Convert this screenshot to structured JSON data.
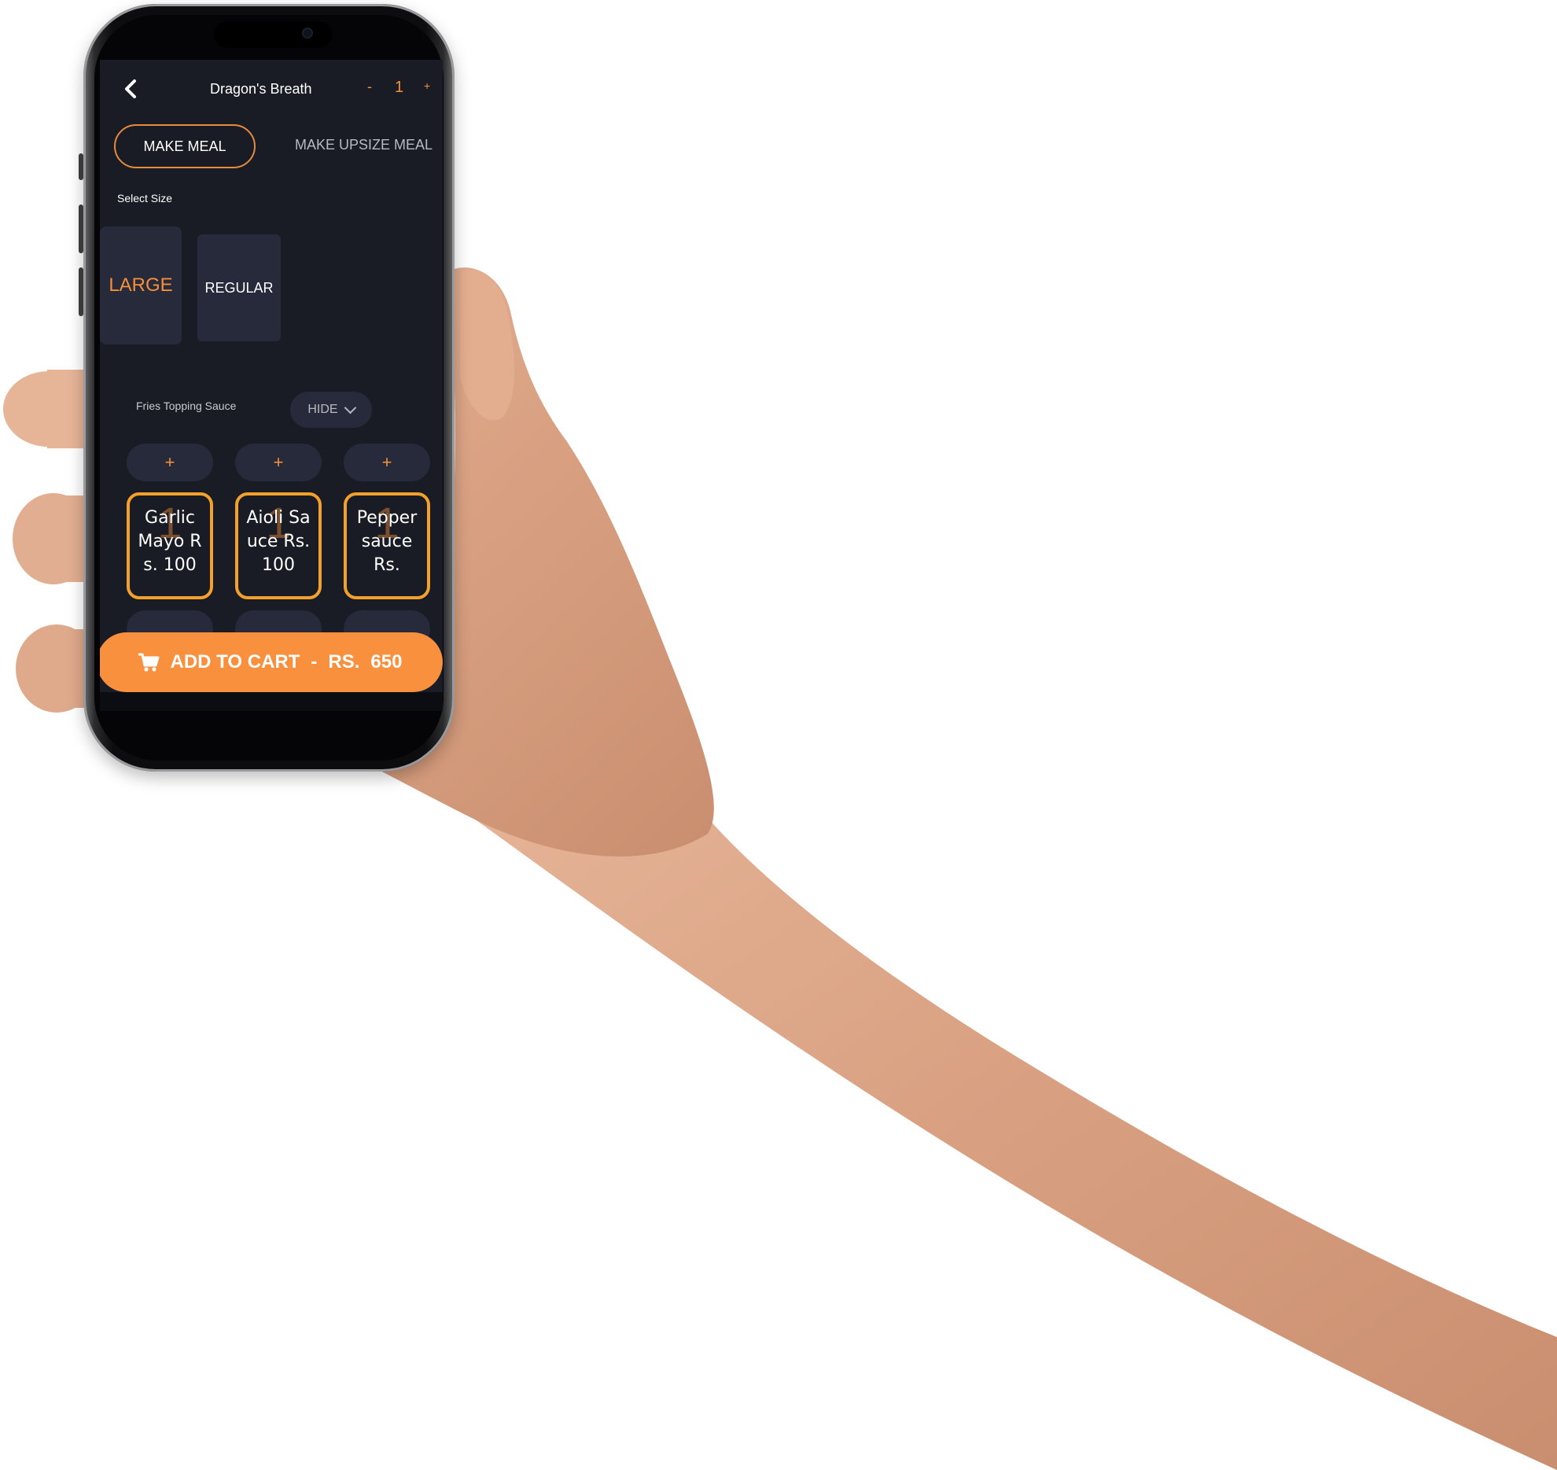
{
  "header": {
    "back_icon": "chevron-left-icon",
    "title": "Dragon's Breath",
    "qty_minus": "-",
    "qty_value": "1",
    "qty_plus": "+"
  },
  "tabs": [
    {
      "label": "MAKE MEAL",
      "active": true
    },
    {
      "label": "MAKE UPSIZE MEAL",
      "active": false
    }
  ],
  "size_section": {
    "label": "Select Size",
    "options": [
      {
        "label": "LARGE",
        "selected": true
      },
      {
        "label": "REGULAR",
        "selected": false
      }
    ]
  },
  "sauce_section": {
    "label": "Fries Topping Sauce",
    "toggle_label": "HIDE",
    "toggle_icon": "chevron-down-icon",
    "items": [
      {
        "plus": "+",
        "count": "1",
        "name": "Garlic Mayo Rs. 100"
      },
      {
        "plus": "+",
        "count": "1",
        "name": "Aioli Sauce Rs. 100"
      },
      {
        "plus": "+",
        "count": "1",
        "name": "Pepper sauce Rs."
      }
    ]
  },
  "cart": {
    "icon": "cart-icon",
    "label": "ADD TO CART",
    "separator": "-",
    "price_label": "RS.",
    "price_value": "650"
  },
  "colors": {
    "accent": "#f4903a",
    "screen_bg": "#1a1c25",
    "card_bg": "#262a3a",
    "card_border": "#f4a12c"
  }
}
